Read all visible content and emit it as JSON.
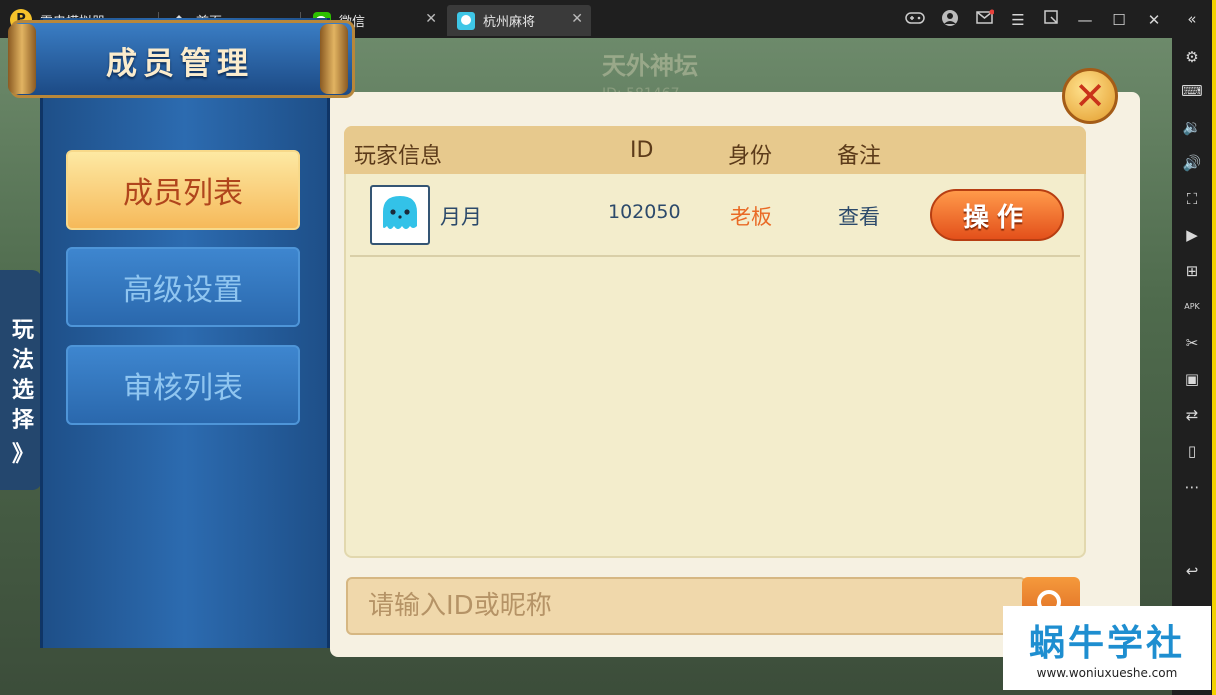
{
  "app": {
    "title": "雷电模拟器",
    "logo_glyph": "P"
  },
  "tabs": [
    {
      "label": "首页",
      "icon": "home-icon"
    },
    {
      "label": "微信",
      "icon": "wechat-icon"
    },
    {
      "label": "杭州麻将",
      "icon": "mahjong-app-icon"
    }
  ],
  "window_controls": {
    "gamepad": "gamepad-icon",
    "account": "account-icon",
    "mail": "mail-icon",
    "menu": "menu-icon",
    "screenshot": "screenshot-icon",
    "minimize": "minimize-icon",
    "maximize": "maximize-icon",
    "close": "close-icon",
    "collapse": "collapse-sidebar-icon"
  },
  "sidebar": [
    "settings-icon",
    "keyboard-icon",
    "volume-down-icon",
    "volume-up-icon",
    "fullscreen-icon",
    "record-icon",
    "add-icon",
    "apk-icon",
    "cut-icon",
    "video-icon",
    "sync-icon",
    "shake-icon",
    "more-icon",
    "back-icon"
  ],
  "background": {
    "title": "天外神坛",
    "subtitle": "ID: 581467"
  },
  "panel": {
    "title": "成员管理",
    "menu": [
      {
        "label": "成员列表",
        "active": true
      },
      {
        "label": "高级设置",
        "active": false
      },
      {
        "label": "审核列表",
        "active": false
      }
    ],
    "side_tab": [
      "玩",
      "法",
      "选",
      "择",
      "》"
    ]
  },
  "table": {
    "headers": [
      "玩家信息",
      "ID",
      "身份",
      "备注"
    ],
    "rows": [
      {
        "name": "月月",
        "id": "102050",
        "role": "老板",
        "note": "查看",
        "action": "操作"
      }
    ]
  },
  "search": {
    "placeholder": "请输入ID或昵称"
  },
  "watermark": {
    "title": "蜗牛学社",
    "url": "www.woniuxueshe.com"
  },
  "colors": {
    "accent": "#f5c22b",
    "role": "#e96a25",
    "link": "#2c4a6b"
  }
}
